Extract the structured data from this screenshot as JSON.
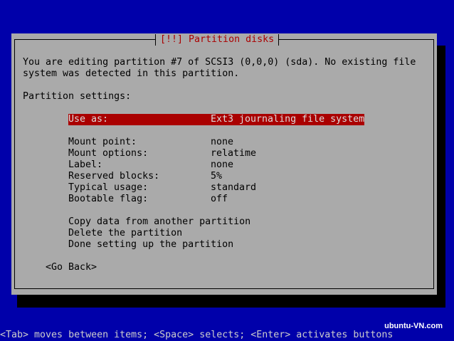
{
  "dialog": {
    "title": "[!!] Partition disks",
    "description_line1": "You are editing partition #7 of SCSI3 (0,0,0) (sda). No existing file",
    "description_line2": "system was detected in this partition.",
    "settings_heading": "Partition settings:",
    "settings": [
      {
        "label": "Use as:",
        "value": "Ext3 journaling file system",
        "selected": true
      },
      {
        "label": "Mount point:",
        "value": "none"
      },
      {
        "label": "Mount options:",
        "value": "relatime"
      },
      {
        "label": "Label:",
        "value": "none"
      },
      {
        "label": "Reserved blocks:",
        "value": "5%"
      },
      {
        "label": "Typical usage:",
        "value": "standard"
      },
      {
        "label": "Bootable flag:",
        "value": "off"
      }
    ],
    "actions": [
      "Copy data from another partition",
      "Delete the partition",
      "Done setting up the partition"
    ],
    "go_back": "<Go Back>"
  },
  "help_line": "<Tab> moves between items; <Space> selects; <Enter> activates buttons",
  "watermark": "ubuntu-VN.com",
  "colors": {
    "background": "#0000aa",
    "dialog": "#aaaaaa",
    "title": "#aa0000",
    "selection": "#aa0000"
  }
}
